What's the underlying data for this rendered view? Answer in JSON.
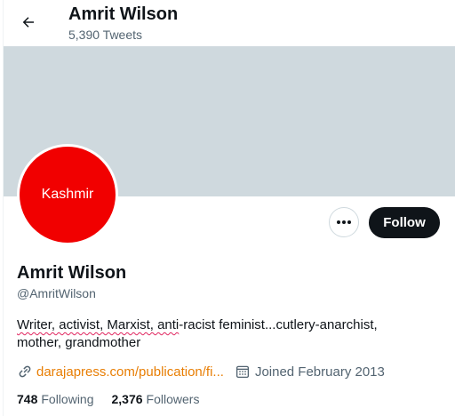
{
  "header": {
    "back_icon": "arrow-left-icon",
    "name": "Amrit Wilson",
    "tweet_count": "5,390 Tweets"
  },
  "banner": {
    "color": "#cfd9de"
  },
  "avatar": {
    "text": "Kashmir",
    "color": "#f10000"
  },
  "actions": {
    "more_icon": "ellipsis-icon",
    "follow_label": "Follow"
  },
  "profile": {
    "display_name": "Amrit Wilson",
    "handle": "@AmritWilson",
    "bio_misspelled": "Writer, activist, Marxist, anti",
    "bio_rest": "-racist feminist...cutlery-anarchist, mother, grandmother",
    "link_icon": "link-icon",
    "link_text": "darajapress.com/publication/fi...",
    "calendar_icon": "calendar-icon",
    "joined": "Joined February 2013"
  },
  "stats": {
    "following_count": "748",
    "following_label": "Following",
    "followers_count": "2,376",
    "followers_label": "Followers"
  },
  "colors": {
    "accent_link": "#e87e04",
    "text_primary": "#0f1419",
    "text_secondary": "#536471"
  }
}
